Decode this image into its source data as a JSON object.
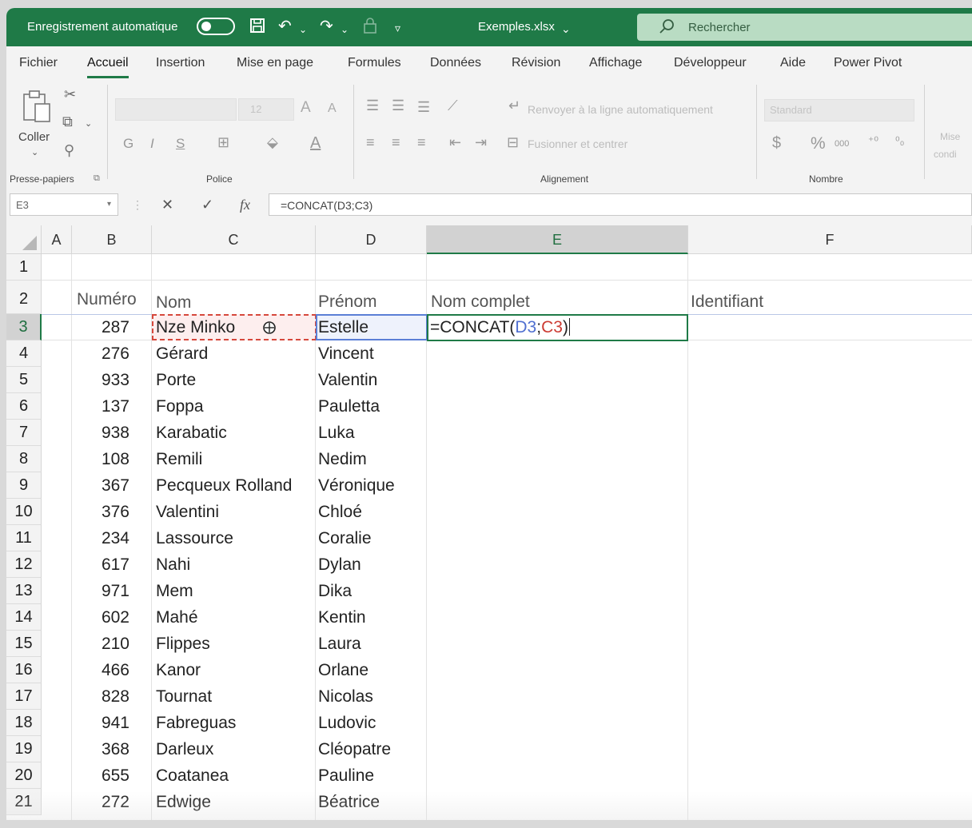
{
  "titlebar": {
    "autosave_label": "Enregistrement automatique",
    "filename": "Exemples.xlsx",
    "search_placeholder": "Rechercher"
  },
  "menu": [
    "Fichier",
    "Accueil",
    "Insertion",
    "Mise en page",
    "Formules",
    "Données",
    "Révision",
    "Affichage",
    "Développeur",
    "Aide",
    "Power Pivot"
  ],
  "ribbon": {
    "clipboard": {
      "paste_label": "Coller",
      "group_label": "Presse-papiers"
    },
    "font": {
      "size": "12",
      "bold": "G",
      "italic": "I",
      "underline": "S",
      "grow": "A",
      "shrink": "A",
      "group_label": "Police"
    },
    "alignment": {
      "wrap_label": "Renvoyer à la ligne automatiquement",
      "merge_label": "Fusionner et centrer",
      "group_label": "Alignement"
    },
    "number": {
      "format": "Standard",
      "currency": "$",
      "percent": "%",
      "thousands": "000",
      "group_label": "Nombre"
    },
    "styles": {
      "cond_format_label_1": "Mise",
      "cond_format_label_2": "condi"
    }
  },
  "formula_bar": {
    "name_box": "E3",
    "cancel": "✕",
    "enter": "✓",
    "fx": "fx",
    "formula": "=CONCAT(D3;C3)"
  },
  "columns": [
    "A",
    "B",
    "C",
    "D",
    "E",
    "F"
  ],
  "headers": {
    "numero": "Numéro",
    "nom": "Nom",
    "prenom": "Prénom",
    "nom_complet": "Nom complet",
    "identifiant": "Identifiant"
  },
  "active_cell": {
    "prefix": "=CONCAT(",
    "ref1": "D3",
    "sep": ";",
    "ref2": "C3",
    "suffix": ")"
  },
  "rows": [
    {
      "numero": "287",
      "nom": "Nze Minko",
      "prenom": "Estelle"
    },
    {
      "numero": "276",
      "nom": "Gérard",
      "prenom": "Vincent"
    },
    {
      "numero": "933",
      "nom": "Porte",
      "prenom": "Valentin"
    },
    {
      "numero": "137",
      "nom": "Foppa",
      "prenom": "Pauletta"
    },
    {
      "numero": "938",
      "nom": "Karabatic",
      "prenom": "Luka"
    },
    {
      "numero": "108",
      "nom": "Remili",
      "prenom": "Nedim"
    },
    {
      "numero": "367",
      "nom": "Pecqueux Rolland",
      "prenom": "Véronique"
    },
    {
      "numero": "376",
      "nom": "Valentini",
      "prenom": "Chloé"
    },
    {
      "numero": "234",
      "nom": "Lassource",
      "prenom": "Coralie"
    },
    {
      "numero": "617",
      "nom": "Nahi",
      "prenom": "Dylan"
    },
    {
      "numero": "971",
      "nom": "Mem",
      "prenom": "Dika"
    },
    {
      "numero": "602",
      "nom": "Mahé",
      "prenom": "Kentin"
    },
    {
      "numero": "210",
      "nom": "Flippes",
      "prenom": "Laura"
    },
    {
      "numero": "466",
      "nom": "Kanor",
      "prenom": "Orlane"
    },
    {
      "numero": "828",
      "nom": "Tournat",
      "prenom": "Nicolas"
    },
    {
      "numero": "941",
      "nom": "Fabreguas",
      "prenom": "Ludovic"
    },
    {
      "numero": "368",
      "nom": "Darleux",
      "prenom": "Cléopatre"
    },
    {
      "numero": "655",
      "nom": "Coatanea",
      "prenom": "Pauline"
    },
    {
      "numero": "272",
      "nom": "Edwige",
      "prenom": "Béatrice"
    }
  ],
  "row_numbers": [
    "1",
    "2",
    "3",
    "4",
    "5",
    "6",
    "7",
    "8",
    "9",
    "10",
    "11",
    "12",
    "13",
    "14",
    "15",
    "16",
    "17",
    "18",
    "19",
    "20",
    "21"
  ],
  "colors": {
    "excel_green": "#1f7a47",
    "ref_blue": "#4f6fd0",
    "ref_red": "#cc3b33"
  }
}
